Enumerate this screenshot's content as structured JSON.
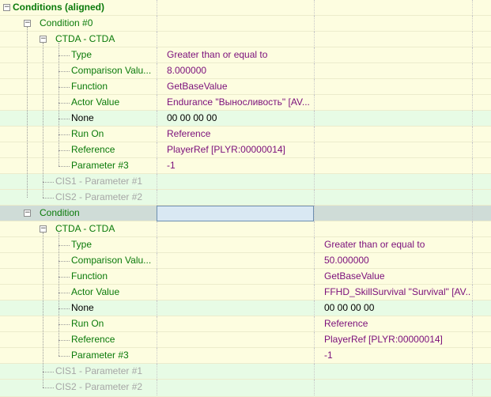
{
  "root_label": "Conditions (aligned)",
  "cond0": {
    "label": "Condition #0",
    "ctda_label": "CTDA - CTDA",
    "fields": [
      {
        "label": "Type",
        "value": "Greater than or equal to"
      },
      {
        "label": "Comparison Valu...",
        "value": "8.000000"
      },
      {
        "label": "Function",
        "value": "GetBaseValue"
      },
      {
        "label": "Actor Value",
        "value": "Endurance \"Выносливость\" [AV..."
      },
      {
        "label": "None",
        "value": "00 00 00 00"
      },
      {
        "label": "Run On",
        "value": "Reference"
      },
      {
        "label": "Reference",
        "value": "PlayerRef [PLYR:00000014]"
      },
      {
        "label": "Parameter #3",
        "value": "-1"
      }
    ],
    "cis1": "CIS1 - Parameter #1",
    "cis2": "CIS2 - Parameter #2"
  },
  "cond1": {
    "label": "Condition",
    "ctda_label": "CTDA - CTDA",
    "fields": [
      {
        "label": "Type",
        "value": "Greater than or equal to"
      },
      {
        "label": "Comparison Valu...",
        "value": "50.000000"
      },
      {
        "label": "Function",
        "value": "GetBaseValue"
      },
      {
        "label": "Actor Value",
        "value": "FFHD_SkillSurvival \"Survival\" [AV..."
      },
      {
        "label": "None",
        "value": "00 00 00 00"
      },
      {
        "label": "Run On",
        "value": "Reference"
      },
      {
        "label": "Reference",
        "value": "PlayerRef [PLYR:00000014]"
      },
      {
        "label": "Parameter #3",
        "value": "-1"
      }
    ],
    "cis1": "CIS1 - Parameter #1",
    "cis2": "CIS2 - Parameter #2"
  },
  "expander_minus": "−",
  "colors": {
    "bg_yellow": "#fdfde0",
    "bg_green": "#e7fbe5",
    "bg_selected": "#cfdcd7",
    "label_green": "#0a7a0a",
    "value_purple": "#7b0f7b",
    "disabled_gray": "#a6a6a6"
  }
}
